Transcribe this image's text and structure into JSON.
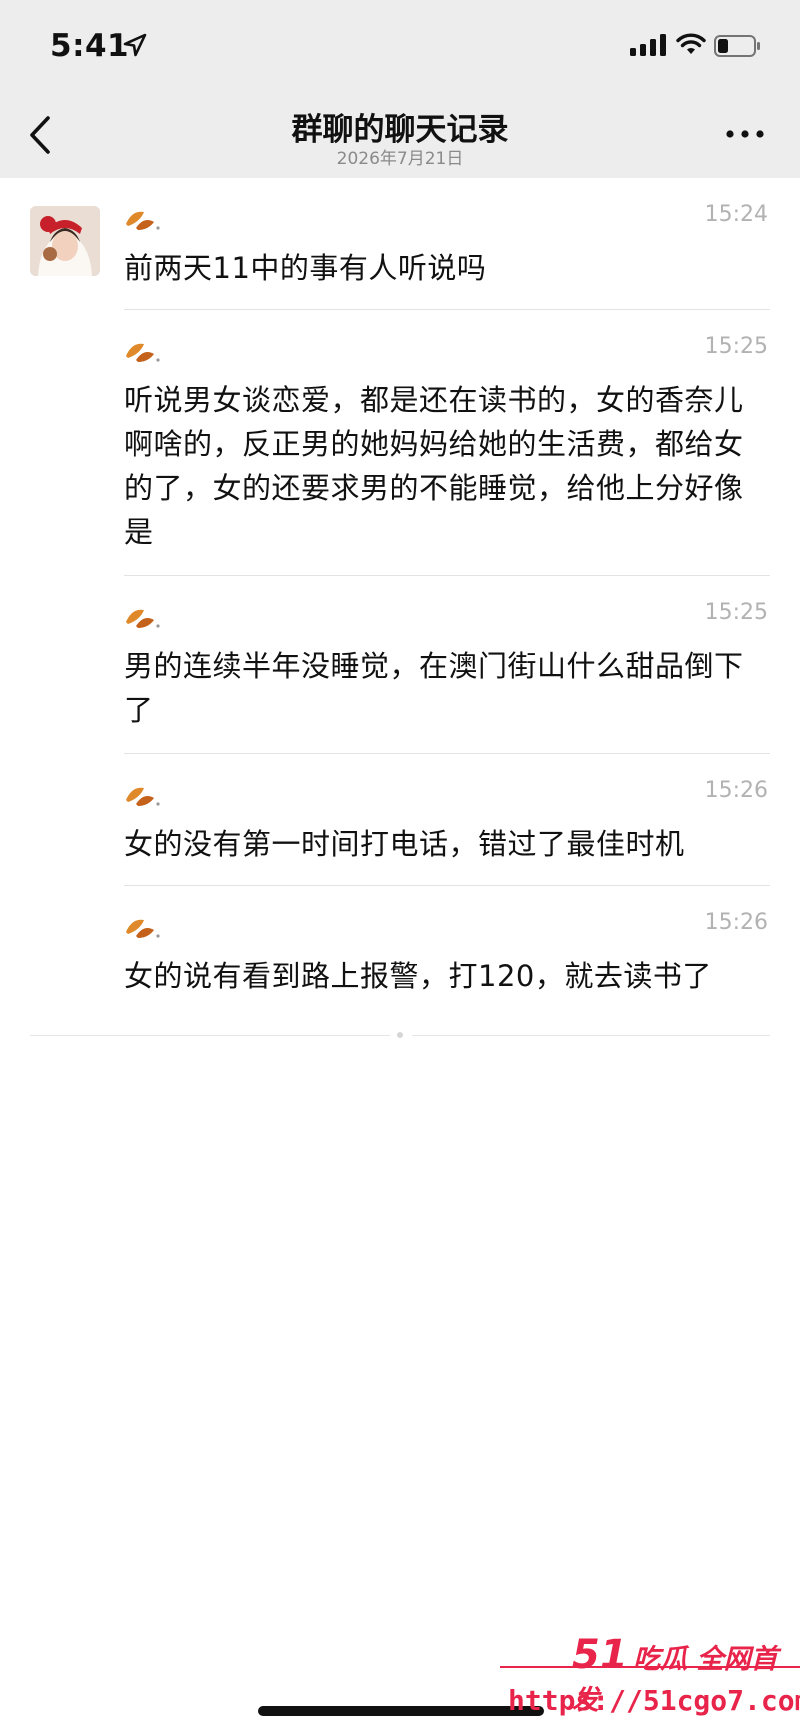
{
  "status": {
    "time": "5:41"
  },
  "nav": {
    "title": "群聊的聊天记录",
    "date": "2026年7月21日"
  },
  "messages": [
    {
      "time": "15:24",
      "text": "前两天11中的事有人听说吗"
    },
    {
      "time": "15:25",
      "text": "听说男女谈恋爱，都是还在读书的，女的香奈儿啊啥的，反正男的她妈妈给她的生活费，都给女的了，女的还要求男的不能睡觉，给他上分好像是"
    },
    {
      "time": "15:25",
      "text": "男的连续半年没睡觉，在澳门街山什么甜品倒下了"
    },
    {
      "time": "15:26",
      "text": "女的没有第一时间打电话，错过了最佳时机"
    },
    {
      "time": "15:26",
      "text": "女的说有看到路上报警，打120，就去读书了"
    }
  ],
  "watermark": {
    "brand_num": "51",
    "brand_text": "吃瓜 全网首发",
    "url": "https://51cgo7.com"
  },
  "icons": {
    "back": "chevron-left-icon",
    "more": "more-dots-icon",
    "location": "location-arrow-icon",
    "signal": "cellular-signal-icon",
    "wifi": "wifi-icon",
    "battery": "battery-icon",
    "sender": "leaf-sticker-icon"
  },
  "colors": {
    "nav_bg": "#ededed",
    "time_text": "#b2b2b2",
    "watermark": "#e8244a"
  }
}
